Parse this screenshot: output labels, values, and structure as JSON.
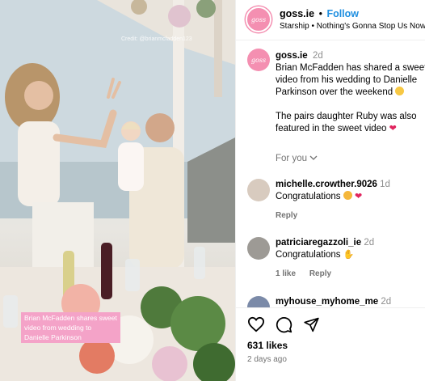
{
  "media": {
    "credit": "Credit: @brianmcfadden123",
    "caption_lines": [
      "Brian McFadden shares sweet",
      "video from wedding to",
      "Danielle Parkinson"
    ]
  },
  "header": {
    "avatar_text": "goss",
    "username": "goss.ie",
    "separator": "•",
    "follow_label": "Follow",
    "song": "Starship • Nothing's Gonna Stop Us Now"
  },
  "post": {
    "username": "goss.ie",
    "time": "2d",
    "text1": "Brian McFadden has shared a sweet video from his wedding to Danielle Parkinson over the weekend",
    "text2": "The pairs daughter Ruby was also featured in the sweet video",
    "for_you": "For you"
  },
  "comments": [
    {
      "username": "michelle.crowther.9026",
      "time": "1d",
      "text": "Congratulations",
      "reply": "Reply",
      "likes": ""
    },
    {
      "username": "patriciaregazzoli_ie",
      "time": "2d",
      "text": "Congratulations",
      "reply": "Reply",
      "likes": "1 like"
    },
    {
      "username": "myhouse_myhome_me",
      "time": "2d",
      "text": "",
      "reply": "",
      "likes": ""
    }
  ],
  "footer": {
    "likes": "631 likes",
    "ago": "2 days ago"
  },
  "colors": {
    "accent": "#1f8fe0",
    "brand_pink": "#f48fb1",
    "caption_bg": "#f4a3c8",
    "heart": "#ed4956"
  },
  "icons": [
    "heart-icon",
    "comment-icon",
    "share-icon",
    "chevron-down-icon"
  ]
}
